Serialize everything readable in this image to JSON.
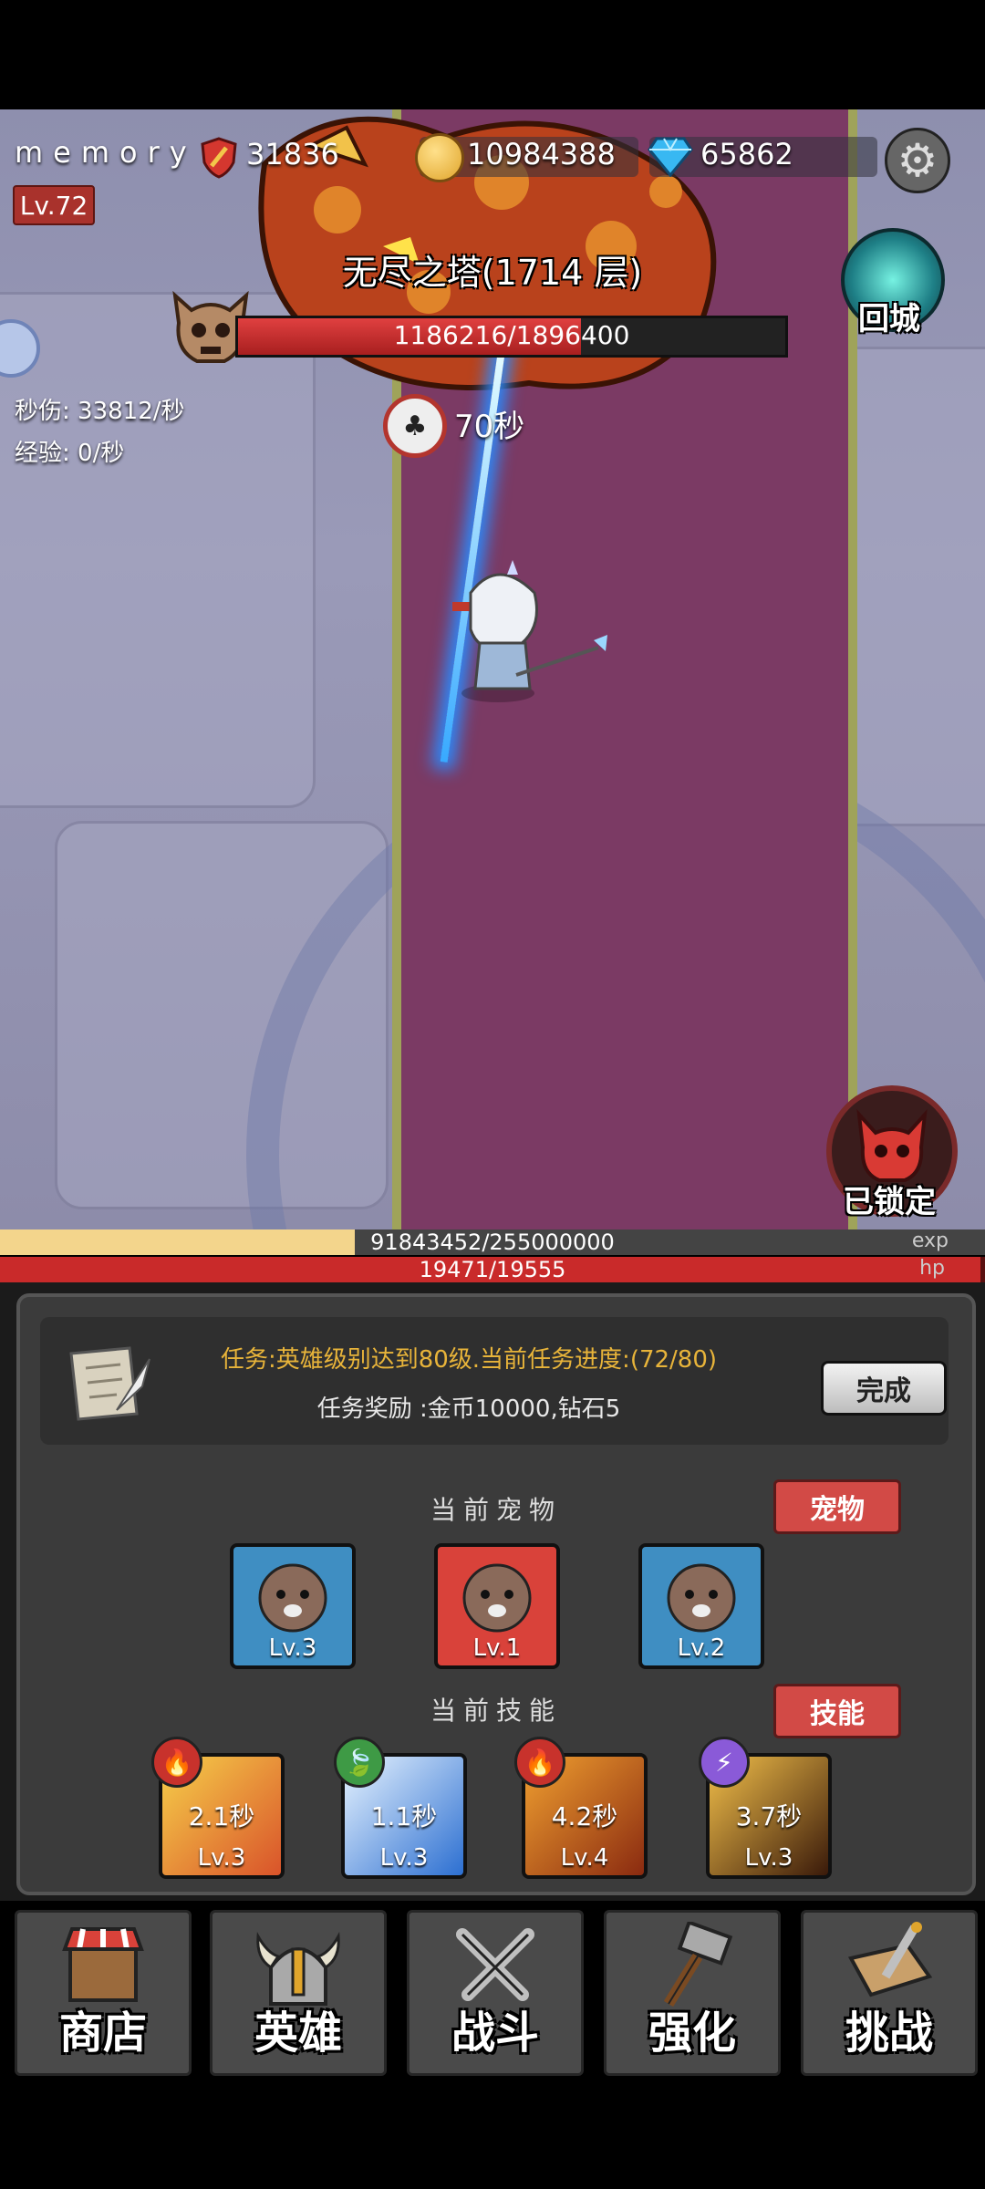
{
  "player": {
    "name": "memory",
    "level": "Lv.72"
  },
  "resources": {
    "power": "31836",
    "gold": "10984388",
    "diamonds": "65862"
  },
  "stage": {
    "title": "无尽之塔(1714 层)",
    "boss_hp": "1186216/1896400",
    "timer": "70秒"
  },
  "stats": {
    "dps": "秒伤: 33812/秒",
    "exp_rate": "经验: 0/秒"
  },
  "buttons": {
    "return_city": "回城",
    "locked": "已锁定",
    "complete": "完成",
    "pets": "宠物",
    "skills": "技能"
  },
  "bars": {
    "exp": {
      "text": "91843452/255000000",
      "tag": "exp",
      "fraction": 0.36
    },
    "hp": {
      "text": "19471/19555",
      "tag": "hp",
      "fraction": 0.995
    }
  },
  "task": {
    "text": "任务:英雄级别达到80级.当前任务进度:(72/80)",
    "reward": "任务奖励 :金币10000,钻石5"
  },
  "sections": {
    "pets": "当前宠物",
    "skills": "当前技能"
  },
  "pets": [
    {
      "level": "Lv.3",
      "bg": "#3f8ec2"
    },
    {
      "level": "Lv.1",
      "bg": "#d9423a"
    },
    {
      "level": "Lv.2",
      "bg": "#3f8ec2"
    }
  ],
  "skills": [
    {
      "cooldown": "2.1秒",
      "level": "Lv.3",
      "element": "fire-icon",
      "elem_color": "#c8322c"
    },
    {
      "cooldown": "1.1秒",
      "level": "Lv.3",
      "element": "leaf-icon",
      "elem_color": "#3e9a45"
    },
    {
      "cooldown": "4.2秒",
      "level": "Lv.4",
      "element": "fire-icon",
      "elem_color": "#c8322c"
    },
    {
      "cooldown": "3.7秒",
      "level": "Lv.3",
      "element": "lightning-icon",
      "elem_color": "#8a5ad8"
    }
  ],
  "nav": [
    "商店",
    "英雄",
    "战斗",
    "强化",
    "挑战"
  ]
}
